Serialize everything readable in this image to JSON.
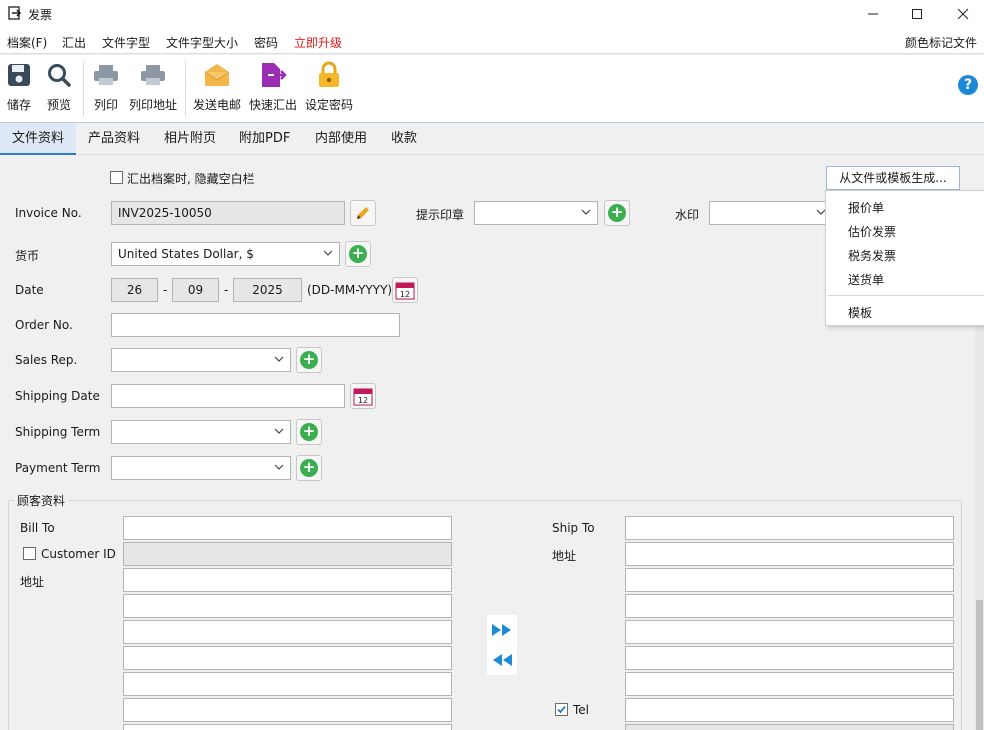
{
  "window": {
    "title": "发票"
  },
  "menu": {
    "items": [
      "档案(F)",
      "汇出",
      "文件字型",
      "文件字型大小",
      "密码",
      "立即升级"
    ],
    "right": "颜色标记文件"
  },
  "toolbar": {
    "save": "储存",
    "preview": "预览",
    "print": "列印",
    "print_address": "列印地址",
    "send_email": "发送电邮",
    "quick_export": "快速汇出",
    "set_password": "设定密码",
    "help": "?"
  },
  "tabs": [
    "文件资料",
    "产品资料",
    "相片附页",
    "附加PDF",
    "内部使用",
    "收款"
  ],
  "form": {
    "hide_blank_label": "汇出档案时, 隐藏空白栏",
    "generate_button": "从文件或模板生成...",
    "invoice_no_label": "Invoice No.",
    "invoice_no_value": "INV2025-10050",
    "stamp_label": "提示印章",
    "watermark_label": "水印",
    "currency_label": "货币",
    "currency_value": "United States Dollar, $",
    "date_label": "Date",
    "date_day": "26",
    "date_month": "09",
    "date_year": "2025",
    "date_dash": "-",
    "date_format": "(DD-MM-YYYY)",
    "order_no_label": "Order No.",
    "sales_rep_label": "Sales Rep.",
    "shipping_date_label": "Shipping Date",
    "shipping_term_label": "Shipping Term",
    "payment_term_label": "Payment Term",
    "calendar_number": "12"
  },
  "dropdown": {
    "items": [
      "报价单",
      "估价发票",
      "税务发票",
      "送货单"
    ],
    "template": "模板"
  },
  "customer": {
    "group_title": "顾客资料",
    "bill_to_label": "Bill To",
    "customer_id_label": "Customer ID",
    "address_label": "地址",
    "ship_to_label": "Ship To",
    "ship_address_label": "地址",
    "tel_label": "Tel"
  },
  "colors": {
    "accent": "#2e7bd4",
    "upgrade": "#e01b1b",
    "add": "#3cae52"
  }
}
